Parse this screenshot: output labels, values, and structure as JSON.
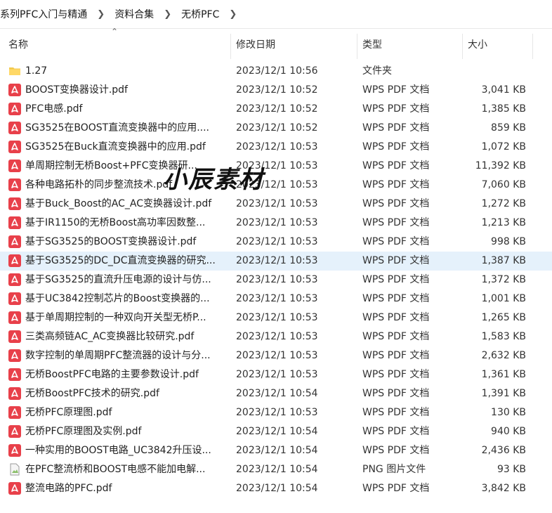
{
  "breadcrumb": [
    "系列PFC入门与精通",
    "资料合集",
    "无桥PFC"
  ],
  "columns": {
    "name": "名称",
    "date": "修改日期",
    "type": "类型",
    "size": "大小"
  },
  "watermark": "小辰素材",
  "files": [
    {
      "name": "1.27",
      "date": "2023/12/1 10:56",
      "type": "文件夹",
      "size": "",
      "icon": "folder-icon"
    },
    {
      "name": "BOOST变换器设计.pdf",
      "date": "2023/12/1 10:52",
      "type": "WPS PDF 文档",
      "size": "3,041 KB",
      "icon": "pdf-icon"
    },
    {
      "name": "PFC电感.pdf",
      "date": "2023/12/1 10:52",
      "type": "WPS PDF 文档",
      "size": "1,385 KB",
      "icon": "pdf-icon"
    },
    {
      "name": "SG3525在BOOST直流变换器中的应用....",
      "date": "2023/12/1 10:52",
      "type": "WPS PDF 文档",
      "size": "859 KB",
      "icon": "pdf-icon"
    },
    {
      "name": "SG3525在Buck直流变换器中的应用.pdf",
      "date": "2023/12/1 10:53",
      "type": "WPS PDF 文档",
      "size": "1,072 KB",
      "icon": "pdf-icon"
    },
    {
      "name": "单周期控制无桥Boost+PFC变换器研...",
      "date": "2023/12/1 10:53",
      "type": "WPS PDF 文档",
      "size": "11,392 KB",
      "icon": "pdf-icon"
    },
    {
      "name": "各种电路拓朴的同步整流技术.pdf",
      "date": "2023/12/1 10:53",
      "type": "WPS PDF 文档",
      "size": "7,060 KB",
      "icon": "pdf-icon"
    },
    {
      "name": "基于Buck_Boost的AC_AC变换器设计.pdf",
      "date": "2023/12/1 10:53",
      "type": "WPS PDF 文档",
      "size": "1,272 KB",
      "icon": "pdf-icon"
    },
    {
      "name": "基于IR1150的无桥Boost高功率因数整...",
      "date": "2023/12/1 10:53",
      "type": "WPS PDF 文档",
      "size": "1,213 KB",
      "icon": "pdf-icon"
    },
    {
      "name": "基于SG3525的BOOST变换器设计.pdf",
      "date": "2023/12/1 10:53",
      "type": "WPS PDF 文档",
      "size": "998 KB",
      "icon": "pdf-icon"
    },
    {
      "name": "基于SG3525的DC_DC直流变换器的研究...",
      "date": "2023/12/1 10:53",
      "type": "WPS PDF 文档",
      "size": "1,387 KB",
      "icon": "pdf-icon",
      "selected": true
    },
    {
      "name": "基于SG3525的直流升压电源的设计与仿...",
      "date": "2023/12/1 10:53",
      "type": "WPS PDF 文档",
      "size": "1,372 KB",
      "icon": "pdf-icon"
    },
    {
      "name": "基于UC3842控制芯片的Boost变换器的...",
      "date": "2023/12/1 10:53",
      "type": "WPS PDF 文档",
      "size": "1,001 KB",
      "icon": "pdf-icon"
    },
    {
      "name": "基于单周期控制的一种双向开关型无桥P...",
      "date": "2023/12/1 10:53",
      "type": "WPS PDF 文档",
      "size": "1,265 KB",
      "icon": "pdf-icon"
    },
    {
      "name": "三类高频链AC_AC变换器比较研究.pdf",
      "date": "2023/12/1 10:53",
      "type": "WPS PDF 文档",
      "size": "1,583 KB",
      "icon": "pdf-icon"
    },
    {
      "name": "数字控制的单周期PFC整流器的设计与分...",
      "date": "2023/12/1 10:53",
      "type": "WPS PDF 文档",
      "size": "2,632 KB",
      "icon": "pdf-icon"
    },
    {
      "name": "无桥BoostPFC电路的主要参数设计.pdf",
      "date": "2023/12/1 10:53",
      "type": "WPS PDF 文档",
      "size": "1,361 KB",
      "icon": "pdf-icon"
    },
    {
      "name": "无桥BoostPFC技术的研究.pdf",
      "date": "2023/12/1 10:54",
      "type": "WPS PDF 文档",
      "size": "1,391 KB",
      "icon": "pdf-icon"
    },
    {
      "name": "无桥PFC原理图.pdf",
      "date": "2023/12/1 10:53",
      "type": "WPS PDF 文档",
      "size": "130 KB",
      "icon": "pdf-icon"
    },
    {
      "name": "无桥PFC原理图及实例.pdf",
      "date": "2023/12/1 10:54",
      "type": "WPS PDF 文档",
      "size": "940 KB",
      "icon": "pdf-icon"
    },
    {
      "name": "一种实用的BOOST电路_UC3842升压设...",
      "date": "2023/12/1 10:54",
      "type": "WPS PDF 文档",
      "size": "2,436 KB",
      "icon": "pdf-icon"
    },
    {
      "name": "在PFC整流桥和BOOST电感不能加电解...",
      "date": "2023/12/1 10:54",
      "type": "PNG 图片文件",
      "size": "93 KB",
      "icon": "png-icon"
    },
    {
      "name": "整流电路的PFC.pdf",
      "date": "2023/12/1 10:54",
      "type": "WPS PDF 文档",
      "size": "3,842 KB",
      "icon": "pdf-icon"
    }
  ]
}
